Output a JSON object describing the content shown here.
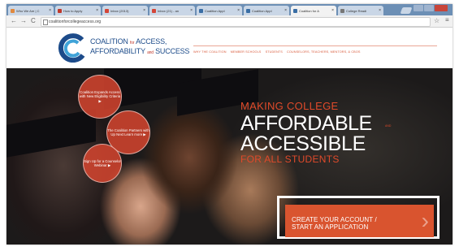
{
  "browser": {
    "tabs": [
      {
        "label": "Who We Are | C",
        "favicon_color": "#e0893f",
        "active": false
      },
      {
        "label": "How to Apply",
        "favicon_color": "#c0392b",
        "active": false
      },
      {
        "label": "Inbox (2013)",
        "favicon_color": "#d44638",
        "active": false
      },
      {
        "label": "Inbox (21) - an",
        "favicon_color": "#d44638",
        "active": false
      },
      {
        "label": "Coalition Appl",
        "favicon_color": "#3a6ea5",
        "active": false
      },
      {
        "label": "Coalition Appl",
        "favicon_color": "#3a6ea5",
        "active": false
      },
      {
        "label": "Coalition for A",
        "favicon_color": "#3a6ea5",
        "active": true
      },
      {
        "label": "College Readi",
        "favicon_color": "#777777",
        "active": false
      }
    ],
    "tab_close": "×",
    "back": "←",
    "forward": "→",
    "reload": "C",
    "url": "coalitionforcollegeaccess.org",
    "star": "☆",
    "menu": "≡"
  },
  "site": {
    "logo_line1": "COALITION",
    "logo_for": "for",
    "logo_access": "ACCESS,",
    "logo_line2": "AFFORDABILITY",
    "logo_and": "and",
    "logo_success": "SUCCESS",
    "nav": [
      "WHY THE COALITION",
      "MEMBER SCHOOLS",
      "STUDENTS",
      "COUNSELORS, TEACHERS, MENTORS, & CBOS"
    ]
  },
  "hero": {
    "circles": [
      {
        "text": "Coalition Expands Access with New Eligibility Criteria ▶"
      },
      {
        "text": "The Coalition Partners with Up Next Learn more ▶"
      },
      {
        "text": "Sign Up for a Counselor Webinar ▶"
      }
    ],
    "headline_1": "MAKING COLLEGE",
    "headline_2": "AFFORDABLE",
    "headline_and": "AND",
    "headline_3": "ACCESSIBLE",
    "headline_4": "FOR ALL STUDENTS",
    "cta_line1": "CREATE YOUR ACCOUNT /",
    "cta_line2": "START AN APPLICATION",
    "cta_arrow": "›"
  },
  "colors": {
    "accent": "#d9542f",
    "brand_blue": "#1c4b8a",
    "tabstrip": "#6c8fb5"
  }
}
